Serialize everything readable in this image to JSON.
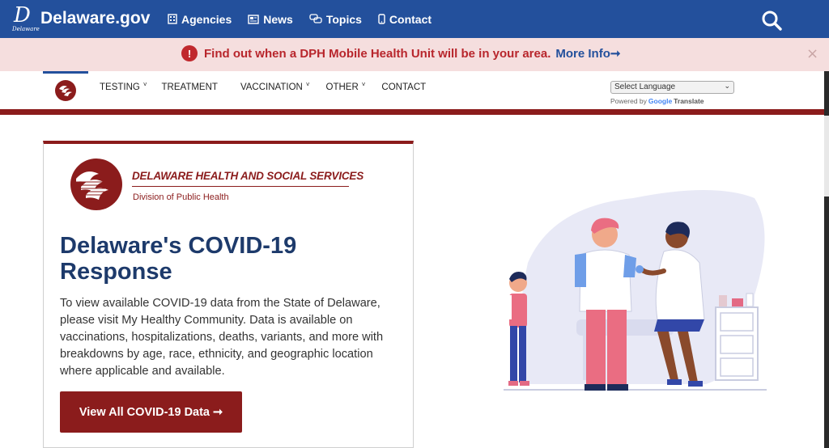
{
  "header": {
    "logo_letter": "D",
    "logo_caption": "Delaware",
    "site_name": "Delaware.gov",
    "nav": [
      {
        "label": "Agencies",
        "icon": "building-icon"
      },
      {
        "label": "News",
        "icon": "newspaper-icon"
      },
      {
        "label": "Topics",
        "icon": "chat-bubbles-icon"
      },
      {
        "label": "Contact",
        "icon": "phone-icon"
      }
    ],
    "colors": {
      "primary": "#23509c"
    }
  },
  "alert": {
    "icon_text": "!",
    "text": "Find out when a DPH Mobile Health Unit will be in your area.",
    "link": "More Info➞",
    "close": "×"
  },
  "subnav": {
    "items": [
      {
        "label": "TESTING",
        "caret": "˅"
      },
      {
        "label": "TREATMENT",
        "caret": ""
      },
      {
        "label": "VACCINATION",
        "caret": "˅"
      },
      {
        "label": "OTHER",
        "caret": "˅"
      },
      {
        "label": "CONTACT",
        "caret": ""
      }
    ],
    "language_select": "Select Language",
    "powered_by": "Powered by",
    "google": "Google",
    "translate": "Translate"
  },
  "card": {
    "org_title": "DELAWARE HEALTH AND SOCIAL SERVICES",
    "org_subtitle": "Division of Public Health",
    "headline": "Delaware's COVID-19 Response",
    "body": "To view available COVID-19 data from the State of Delaware, please visit My Healthy Community. Data is available on vaccinations, hospitalizations, deaths, variants, and more with breakdowns by age, race, ethnicity, and geographic location where applicable and available.",
    "cta": "View All COVID-19 Data ➞",
    "colors": {
      "accent": "#8b1c1c",
      "heading": "#1d3a6b"
    }
  }
}
